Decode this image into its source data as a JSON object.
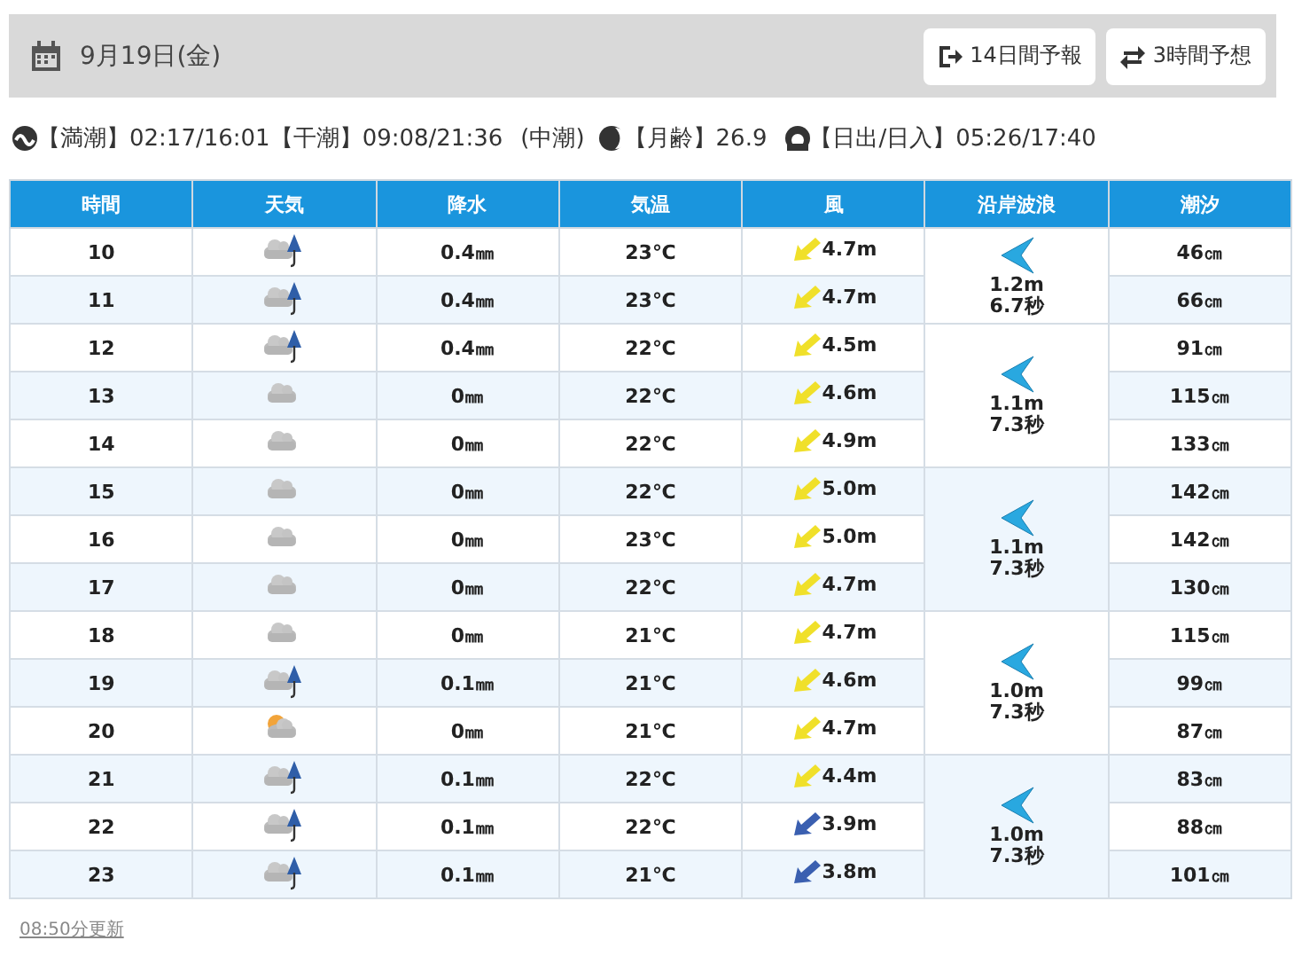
{
  "header": {
    "date": "9月19日(金)",
    "buttons": [
      "14日間予報",
      "3時間予想"
    ]
  },
  "info": {
    "high_tide_label": "【満潮】",
    "high_tide": "02:17/16:01",
    "low_tide_label": "【干潮】",
    "low_tide": "09:08/21:36",
    "tide_type": "(中潮)",
    "moon_age_label": "【月齢】",
    "moon_age": "26.9",
    "sun_label": "【日出/日入】",
    "sun": "05:26/17:40"
  },
  "table": {
    "columns": [
      "時間",
      "天気",
      "降水",
      "気温",
      "風",
      "沿岸波浪",
      "潮汐"
    ],
    "groups": [
      {
        "wave_height": "1.2m",
        "wave_period": "6.7秒",
        "rows": [
          {
            "hour": "10",
            "kind": "rain",
            "precip": "0.4㎜",
            "temp": "23℃",
            "wind": "4.7m",
            "color": "#f0e02a",
            "tide": "46㎝"
          },
          {
            "hour": "11",
            "kind": "rain",
            "precip": "0.4㎜",
            "temp": "23℃",
            "wind": "4.7m",
            "color": "#f0e02a",
            "tide": "66㎝"
          }
        ]
      },
      {
        "wave_height": "1.1m",
        "wave_period": "7.3秒",
        "rows": [
          {
            "hour": "12",
            "kind": "rain",
            "precip": "0.4㎜",
            "temp": "22℃",
            "wind": "4.5m",
            "color": "#f0e02a",
            "tide": "91㎝"
          },
          {
            "hour": "13",
            "kind": "cloudy",
            "precip": "0㎜",
            "temp": "22℃",
            "wind": "4.6m",
            "color": "#f0e02a",
            "tide": "115㎝"
          },
          {
            "hour": "14",
            "kind": "cloudy",
            "precip": "0㎜",
            "temp": "22℃",
            "wind": "4.9m",
            "color": "#f0e02a",
            "tide": "133㎝"
          }
        ]
      },
      {
        "wave_height": "1.1m",
        "wave_period": "7.3秒",
        "rows": [
          {
            "hour": "15",
            "kind": "cloudy",
            "precip": "0㎜",
            "temp": "22℃",
            "wind": "5.0m",
            "color": "#f0e02a",
            "tide": "142㎝"
          },
          {
            "hour": "16",
            "kind": "cloudy",
            "precip": "0㎜",
            "temp": "23℃",
            "wind": "5.0m",
            "color": "#f0e02a",
            "tide": "142㎝"
          },
          {
            "hour": "17",
            "kind": "cloudy",
            "precip": "0㎜",
            "temp": "22℃",
            "wind": "4.7m",
            "color": "#f0e02a",
            "tide": "130㎝"
          }
        ]
      },
      {
        "wave_height": "1.0m",
        "wave_period": "7.3秒",
        "rows": [
          {
            "hour": "18",
            "kind": "cloudy",
            "precip": "0㎜",
            "temp": "21℃",
            "wind": "4.7m",
            "color": "#f0e02a",
            "tide": "115㎝"
          },
          {
            "hour": "19",
            "kind": "rain",
            "precip": "0.1㎜",
            "temp": "21℃",
            "wind": "4.6m",
            "color": "#f0e02a",
            "tide": "99㎝"
          },
          {
            "hour": "20",
            "kind": "partly_sunny",
            "precip": "0㎜",
            "temp": "21℃",
            "wind": "4.7m",
            "color": "#f0e02a",
            "tide": "87㎝"
          }
        ]
      },
      {
        "wave_height": "1.0m",
        "wave_period": "7.3秒",
        "rows": [
          {
            "hour": "21",
            "kind": "rain",
            "precip": "0.1㎜",
            "temp": "22℃",
            "wind": "4.4m",
            "color": "#f0e02a",
            "tide": "83㎝"
          },
          {
            "hour": "22",
            "kind": "rain",
            "precip": "0.1㎜",
            "temp": "22℃",
            "wind": "3.9m",
            "color": "#3a5fb0",
            "tide": "88㎝"
          },
          {
            "hour": "23",
            "kind": "rain",
            "precip": "0.1㎜",
            "temp": "21℃",
            "wind": "3.8m",
            "color": "#3a5fb0",
            "tide": "101㎝"
          }
        ]
      }
    ]
  },
  "updated": "08:50分更新"
}
